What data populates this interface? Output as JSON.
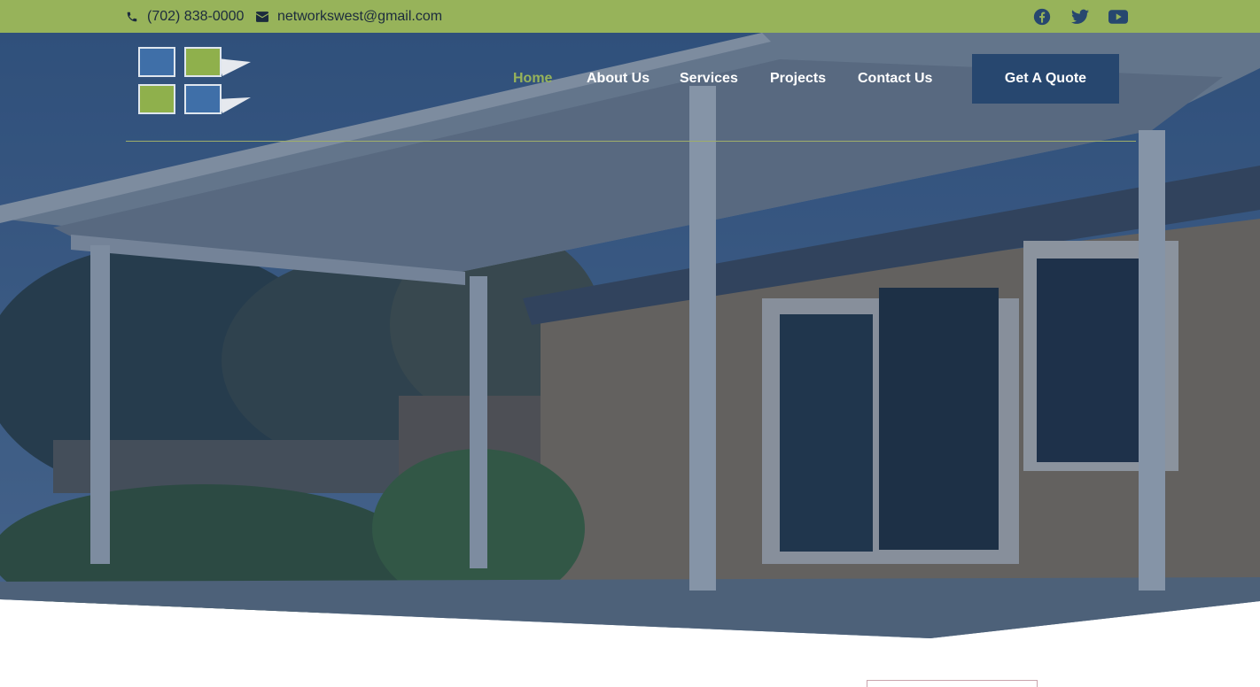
{
  "topbar": {
    "phone": "(702) 838-0000",
    "email": "networkswest@gmail.com",
    "phone_icon": "phone-icon",
    "email_icon": "envelope-icon",
    "social": [
      "facebook-icon",
      "twitter-icon",
      "youtube-icon"
    ],
    "background": "#97b35a"
  },
  "nav": {
    "items": [
      {
        "label": "Home",
        "active": true
      },
      {
        "label": "About Us",
        "active": false
      },
      {
        "label": "Services",
        "active": false
      },
      {
        "label": "Projects",
        "active": false
      },
      {
        "label": "Contact Us",
        "active": false
      }
    ],
    "cta_label": "Get A Quote",
    "active_color": "#97b35a",
    "cta_color": "#27476f"
  },
  "hero": {
    "image": "patio-cover-solar-panels-photo"
  }
}
